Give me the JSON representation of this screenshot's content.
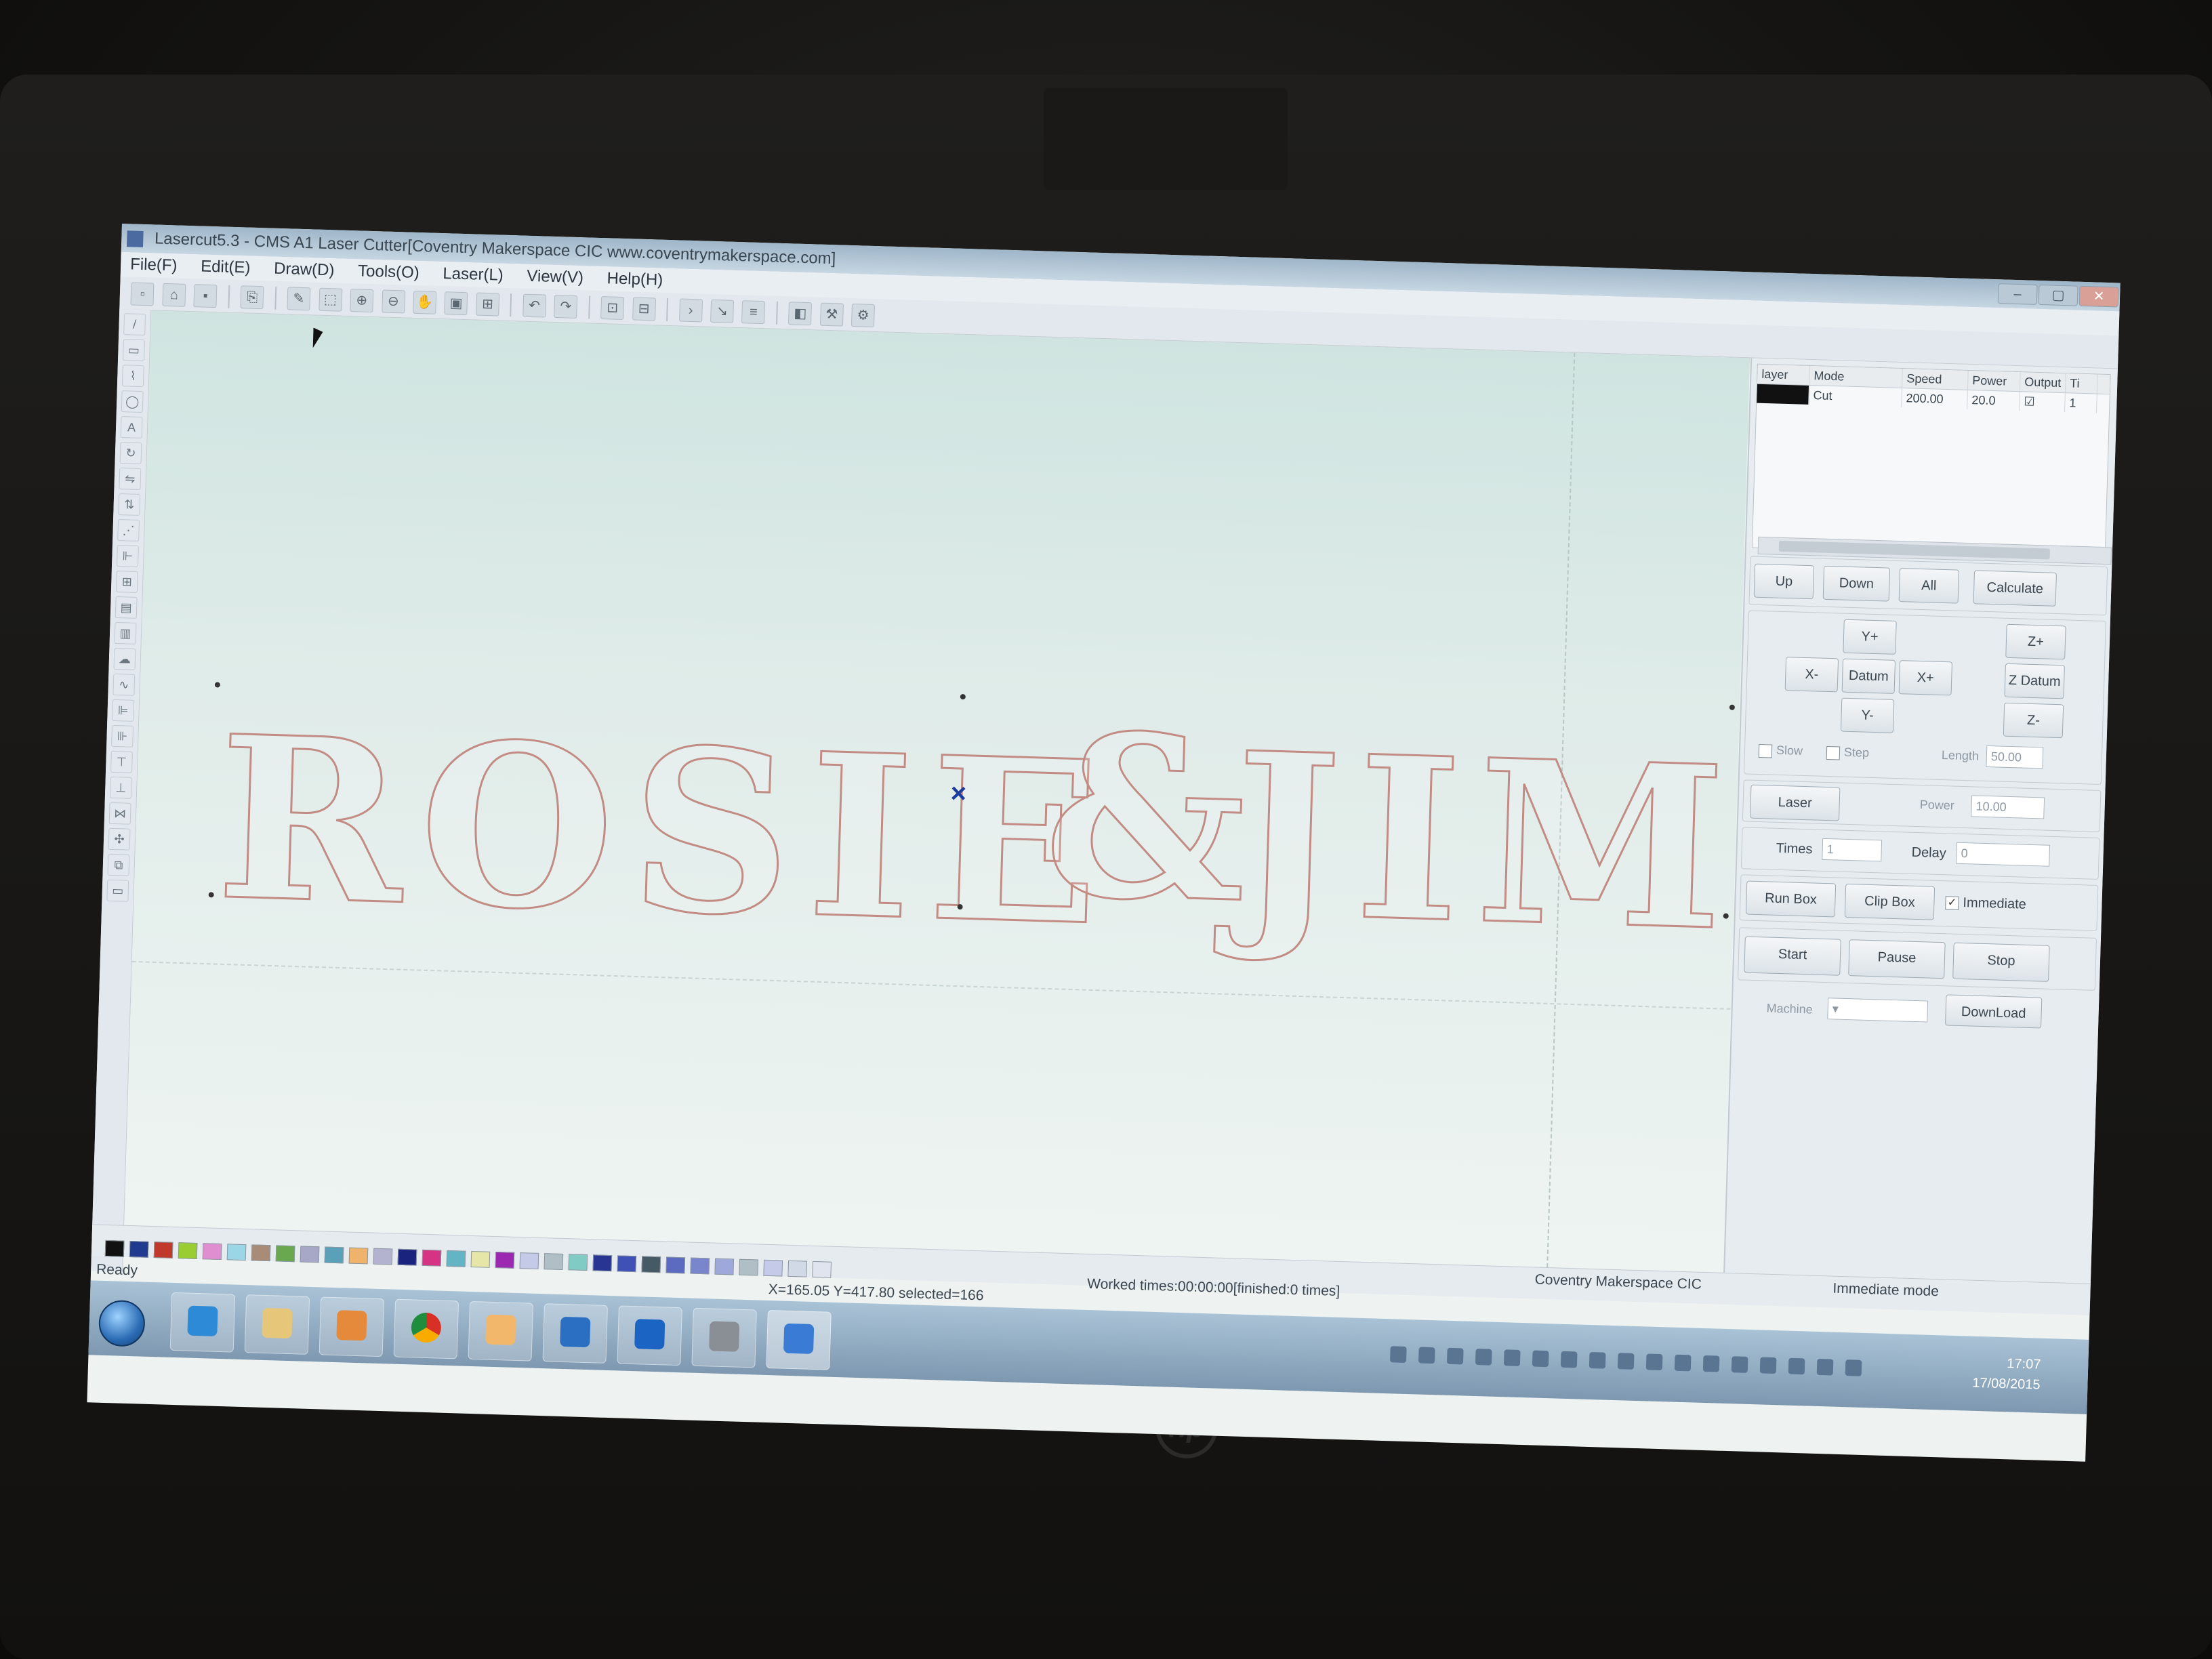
{
  "window": {
    "title": "Lasercut5.3 - CMS A1 Laser Cutter[Coventry Makerspace CIC www.coventrymakerspace.com]"
  },
  "menu": [
    "File(F)",
    "Edit(E)",
    "Draw(D)",
    "Tools(O)",
    "Laser(L)",
    "View(V)",
    "Help(H)"
  ],
  "design": {
    "words": [
      "ROSIE",
      "&",
      "JIM"
    ],
    "stroke_color": "#c28c84"
  },
  "layers": {
    "headers": [
      "layer",
      "Mode",
      "Speed",
      "Power",
      "Output",
      "Ti"
    ],
    "rows": [
      {
        "color": "#111111",
        "mode": "Cut",
        "speed": "200.00",
        "power": "20.0",
        "output": true,
        "times": "1"
      }
    ]
  },
  "panel": {
    "up": "Up",
    "down": "Down",
    "all": "All",
    "calculate": "Calculate",
    "y_plus": "Y+",
    "y_minus": "Y-",
    "x_minus": "X-",
    "x_plus": "X+",
    "datum": "Datum",
    "z_plus": "Z+",
    "z_datum": "Z Datum",
    "z_minus": "Z-",
    "slow": "Slow",
    "step": "Step",
    "length_label": "Length",
    "length_value": "50.00",
    "laser": "Laser",
    "power_label": "Power",
    "power_value": "10.00",
    "times_label": "Times",
    "times_value": "1",
    "delay_label": "Delay",
    "delay_value": "0",
    "run_box": "Run Box",
    "clip_box": "Clip Box",
    "immediate": "Immediate",
    "start": "Start",
    "pause": "Pause",
    "stop": "Stop",
    "machine_label": "Machine",
    "download": "DownLoad"
  },
  "status": {
    "coords": "X=165.05 Y=417.80 selected=166",
    "worked": "Worked times:00:00:00[finished:0 times]",
    "company": "Coventry Makerspace CIC",
    "mode": "Immediate mode",
    "ready": "Ready"
  },
  "palette": [
    "#111111",
    "#1f3a8f",
    "#c0392b",
    "#9acd32",
    "#e08ed0",
    "#9bd6e6",
    "#a98c77",
    "#6aa84f",
    "#a7a7c8",
    "#5aa0b8",
    "#f0b36b",
    "#b3b3cf",
    "#1a237e",
    "#d63384",
    "#64b5c4",
    "#e6e6a8",
    "#9c27b0",
    "#c5cae9",
    "#b0bec5",
    "#80cbc4",
    "#283593",
    "#3f51b5",
    "#455a64",
    "#5c6bc0",
    "#7986cb",
    "#9fa8da",
    "#b0bec5",
    "#c5cae9",
    "#d1d9e6",
    "#dfe4ee"
  ],
  "clock": {
    "time": "17:07",
    "date": "17/08/2015"
  },
  "brand": {
    "logo": "hp"
  }
}
